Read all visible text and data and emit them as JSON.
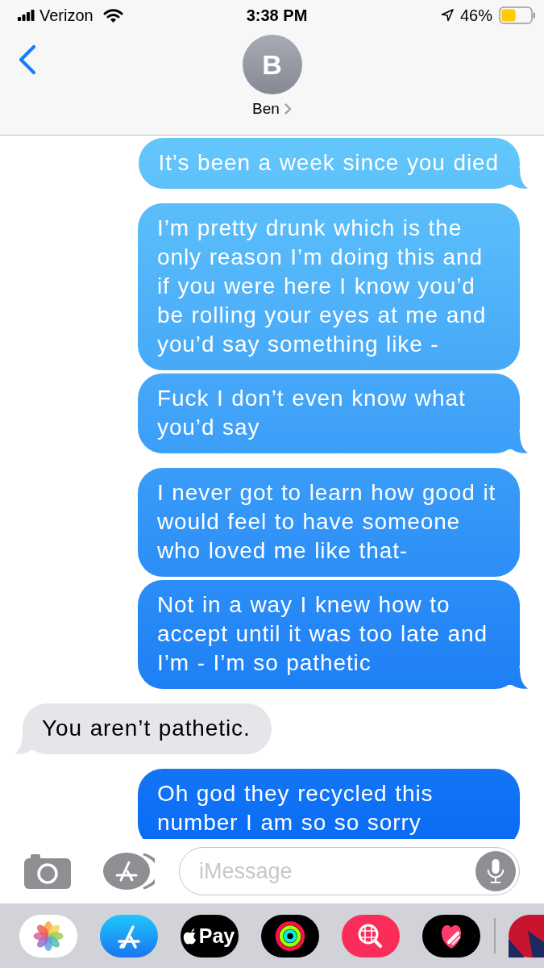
{
  "status_bar": {
    "carrier": "Verizon",
    "time": "3:38 PM",
    "battery": "46%"
  },
  "header": {
    "avatar_initial": "B",
    "contact_name": "Ben"
  },
  "messages": [
    {
      "kind": "sent",
      "text": "It’s been a week since you died",
      "tail": true
    },
    {
      "kind": "sent",
      "text": "I’m pretty drunk which is the only reason I’m doing this and if you were here I know you’d be rolling your eyes at me and you’d say something like -",
      "tail": false
    },
    {
      "kind": "sent",
      "text": "Fuck I don’t even know what you’d say",
      "tail": true
    },
    {
      "kind": "sent",
      "text": "I never got to learn how good it would feel to have someone who loved me like that-",
      "tail": false
    },
    {
      "kind": "sent",
      "text": "Not in a way I knew how to accept until it was too late and I’m - I’m so pathetic",
      "tail": true
    },
    {
      "kind": "received",
      "text": "You aren’t pathetic.",
      "tail": true
    },
    {
      "kind": "sent",
      "text": "Oh god they recycled this number I am so so sorry",
      "tail": false
    }
  ],
  "composer": {
    "placeholder": "iMessage"
  },
  "app_drawer": [
    {
      "kind": "photos"
    },
    {
      "kind": "store"
    },
    {
      "kind": "pay",
      "label": "Pay"
    },
    {
      "kind": "activity"
    },
    {
      "kind": "search"
    },
    {
      "kind": "heart"
    },
    {
      "kind": "partial"
    }
  ]
}
